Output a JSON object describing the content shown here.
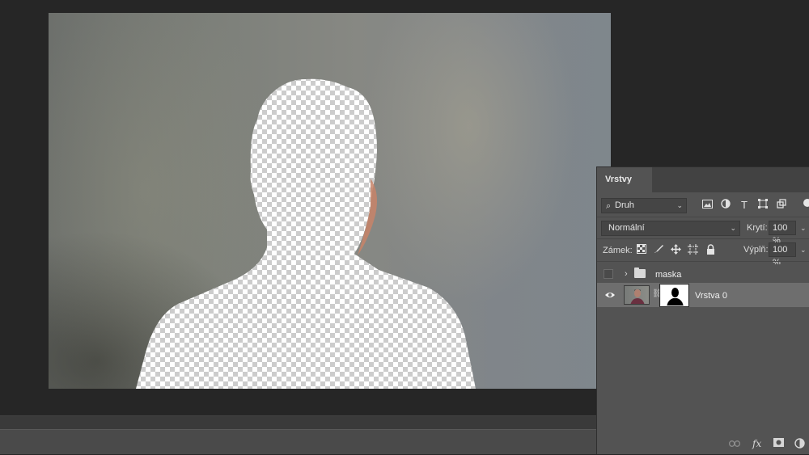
{
  "canvas": {
    "background_note_color": "#80837f",
    "transparent_pattern": "checkerboard"
  },
  "layers_panel": {
    "tab_label": "Vrstvy",
    "filter": {
      "kind_label": "Druh",
      "icons": [
        "image-filter-icon",
        "adjustment-filter-icon",
        "type-filter-icon",
        "shape-filter-icon",
        "smart-object-filter-icon"
      ]
    },
    "blend_mode": "Normální",
    "opacity_label": "Krytí:",
    "opacity_value": "100 %",
    "lock_label": "Zámek:",
    "fill_label": "Výplň:",
    "fill_value": "100 %",
    "layers": [
      {
        "name": "maska",
        "type": "group",
        "visible": false
      },
      {
        "name": "Vrstva 0",
        "type": "layer",
        "visible": true,
        "has_mask": true,
        "selected": true
      }
    ],
    "footer_icons": [
      "link-layers-icon",
      "fx-icon",
      "add-mask-icon",
      "adjustment-layer-icon"
    ],
    "fx_label": "fx"
  },
  "colors": {
    "panel_bg": "#535353",
    "selected_layer": "#6e6e6e",
    "workspace_bg": "#262626"
  }
}
